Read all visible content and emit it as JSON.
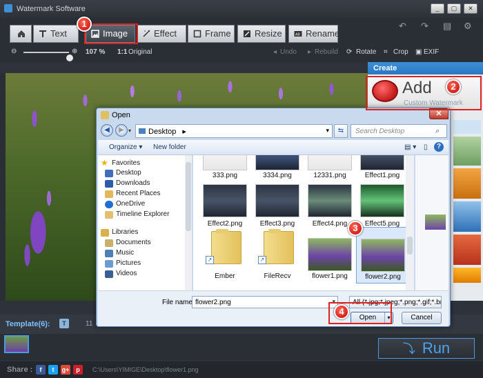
{
  "app": {
    "title": "Watermark Software",
    "window_buttons": [
      "_",
      "▢",
      "✕"
    ]
  },
  "tabs": [
    {
      "label": "",
      "icon": "home-icon"
    },
    {
      "label": "Text",
      "icon": "text-icon"
    },
    {
      "label": "Image",
      "icon": "image-icon"
    },
    {
      "label": "Effect",
      "icon": "effect-icon"
    },
    {
      "label": "Frame",
      "icon": "frame-icon"
    },
    {
      "label": "Resize",
      "icon": "resize-icon"
    },
    {
      "label": "Rename",
      "icon": "rename-icon"
    }
  ],
  "toolbar": {
    "zoom": "107 %",
    "original": "Original",
    "original_icon": "1:1",
    "undo": "Undo",
    "rebuild": "Rebuild",
    "rotate": "Rotate",
    "crop": "Crop",
    "exif": "EXIF"
  },
  "panel": {
    "create": "Create",
    "add_big": "Add",
    "add_small": "Custom Watermark"
  },
  "template": {
    "label": "Template(6):",
    "count": "11"
  },
  "run": "Run",
  "share": {
    "label": "Share :",
    "path": "C:\\Users\\YIMIGE\\Desktop\\flower1.png",
    "icons": [
      "f",
      "t",
      "g+",
      "p"
    ],
    "colors": [
      "#3b5998",
      "#1da1f2",
      "#dd4b39",
      "#cb2027"
    ]
  },
  "dialog": {
    "title": "Open",
    "close": "✕",
    "location": "Desktop",
    "search_placeholder": "Search Desktop",
    "organize": "Organize ▾",
    "new_folder": "New folder",
    "nav": {
      "favorites": "Favorites",
      "fav_items": [
        "Desktop",
        "Downloads",
        "Recent Places",
        "OneDrive",
        "Timeline Explorer"
      ],
      "libraries": "Libraries",
      "lib_items": [
        "Documents",
        "Music",
        "Pictures",
        "Videos"
      ]
    },
    "files_row1": [
      "333.png",
      "3334.png",
      "12331.png",
      "Effect1.png"
    ],
    "files_row2": [
      "Effect2.png",
      "Effect3.png",
      "Effect4.png",
      "Effect5.png"
    ],
    "files_row3": [
      "Ember",
      "FileRecv",
      "flower1.png",
      "flower2.png"
    ],
    "file_name_label": "File name:",
    "file_name": "flower2.png",
    "file_type": "All (*.jpg;*.jpeg;*.png;*.gif;*.bm",
    "open": "Open",
    "cancel": "Cancel"
  },
  "badges": [
    "1",
    "2",
    "3",
    "4"
  ]
}
